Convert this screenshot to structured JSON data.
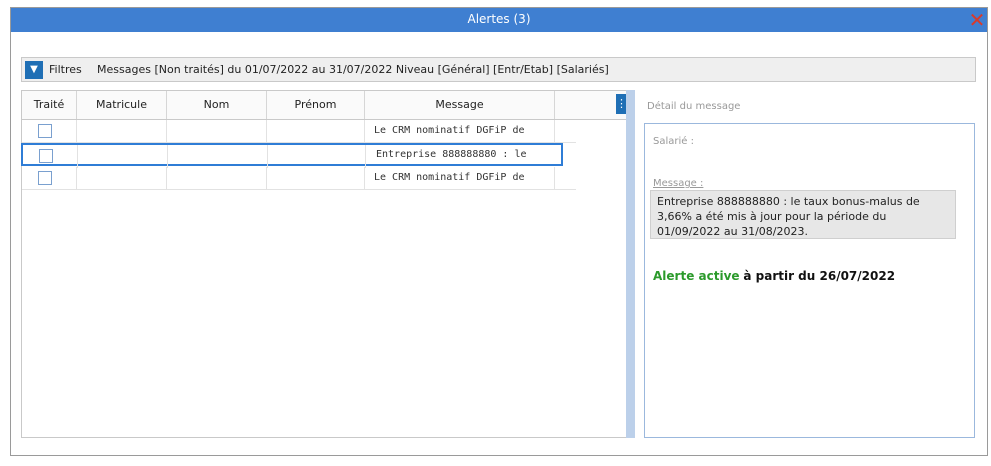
{
  "window": {
    "title": "Alertes (3)",
    "close_icon": "close-icon"
  },
  "filters": {
    "label": "Filtres",
    "text": "Messages  [Non traités] du 01/07/2022 au 31/07/2022 Niveau [Général] [Entr/Etab] [Salariés]"
  },
  "grid": {
    "columns": [
      "Traité",
      "Matricule",
      "Nom",
      "Prénom",
      "Message"
    ],
    "rows": [
      {
        "message": "Le CRM nominatif DGFiP de",
        "checked": false,
        "selected": false
      },
      {
        "message": "Entreprise 888888880 : le",
        "checked": false,
        "selected": true
      },
      {
        "message": "Le CRM nominatif DGFiP de",
        "checked": false,
        "selected": false
      }
    ]
  },
  "detail": {
    "title": "Détail du message",
    "salarie_label": "Salarié :",
    "message_label": "Message :",
    "message_text": "Entreprise 888888880 : le taux bonus-malus de 3,66% a été mis à jour pour la période du 01/09/2022 au 31/08/2023.",
    "alert_status": "Alerte active",
    "alert_date": "à partir du 26/07/2022"
  },
  "colors": {
    "titlebar": "#3f7fd1",
    "accent": "#1f6fb5",
    "alert_green": "#2b9a2b",
    "close": "#d93a2b"
  }
}
